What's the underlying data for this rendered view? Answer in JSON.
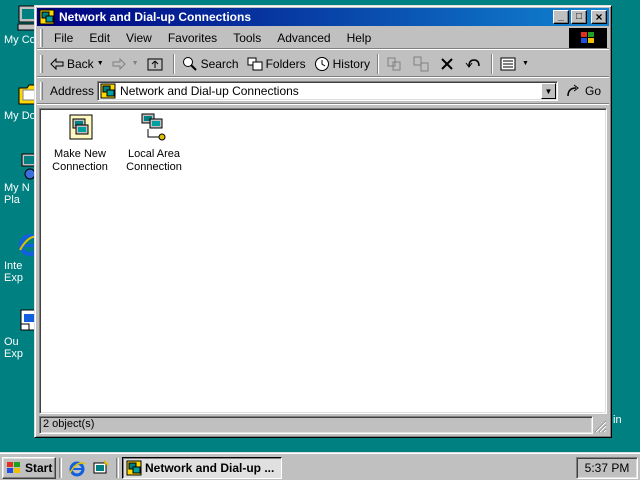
{
  "desktop": {
    "icons": [
      {
        "label": "My Co",
        "icon": "my-computer-icon"
      },
      {
        "label": "My Do",
        "icon": "my-documents-icon"
      },
      {
        "label": "My N\nPla",
        "icon": "my-network-places-icon"
      },
      {
        "label": "Inte\nExp",
        "icon": "internet-explorer-icon"
      },
      {
        "label": "Ou\nExp",
        "icon": "outlook-express-icon"
      }
    ],
    "edge_text": "in"
  },
  "window": {
    "title": "Network and Dial-up Connections",
    "controls": {
      "minimize": "_",
      "maximize": "□",
      "close": "×"
    }
  },
  "menubar": {
    "items": [
      "File",
      "Edit",
      "View",
      "Favorites",
      "Tools",
      "Advanced",
      "Help"
    ]
  },
  "toolbar": {
    "back": "Back",
    "search": "Search",
    "folders": "Folders",
    "history": "History"
  },
  "addressbar": {
    "label": "Address",
    "value": "Network and Dial-up Connections",
    "go": "Go"
  },
  "content": {
    "items": [
      {
        "label": "Make New\nConnection",
        "icon": "make-new-connection-icon"
      },
      {
        "label": "Local Area\nConnection",
        "icon": "local-area-connection-icon"
      }
    ]
  },
  "statusbar": {
    "text": "2 object(s)"
  },
  "taskbar": {
    "start": "Start",
    "task_label": "Network and Dial-up ...",
    "clock": "5:37 PM"
  },
  "colors": {
    "desktop": "#008080",
    "titlebar": "#000080",
    "face": "#c0c0c0"
  }
}
